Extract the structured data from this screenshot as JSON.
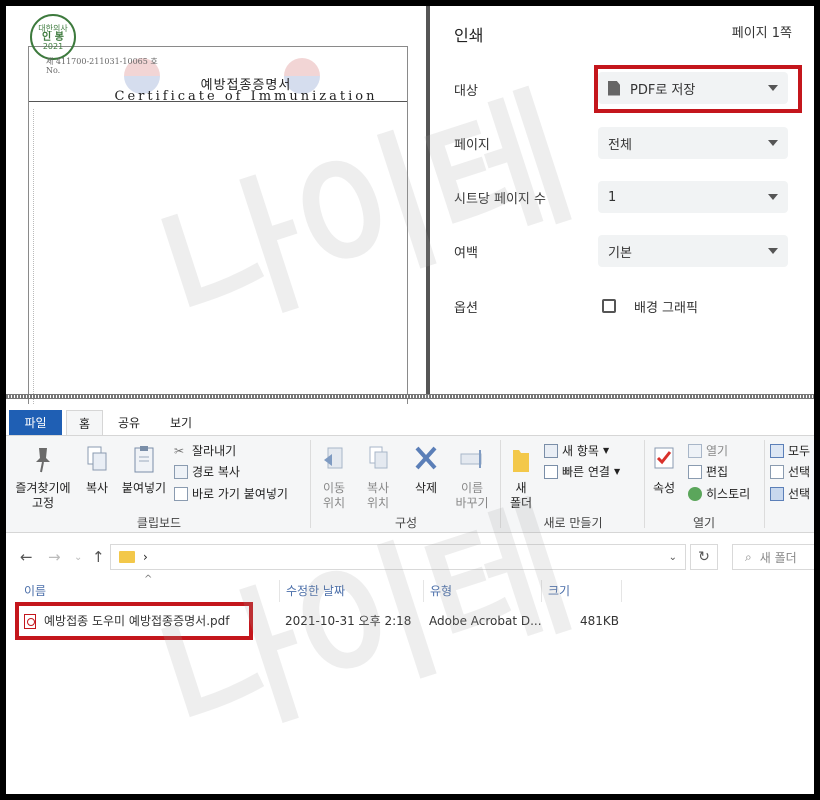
{
  "preview": {
    "stamp_top": "대한의사",
    "stamp_center": "인 봉",
    "stamp_bottom": "2021",
    "doc_number": "제  411700-211031-10065  호",
    "doc_no_label": "No.",
    "doc_title_kr": "예방접종증명서",
    "doc_title_en": "Certificate of Immunization"
  },
  "print_dialog": {
    "title": "인쇄",
    "page_count": "페이지 1쪽",
    "rows": [
      {
        "label": "대상",
        "value": "PDF로 저장",
        "icon": "pdf-file-icon",
        "highlighted": true
      },
      {
        "label": "페이지",
        "value": "전체"
      },
      {
        "label": "시트당 페이지 수",
        "value": "1"
      },
      {
        "label": "여백",
        "value": "기본"
      }
    ],
    "options_label": "옵션",
    "background_graphics_label": "배경 그래픽",
    "background_graphics_checked": false,
    "highlight_color": "#c4161c"
  },
  "explorer": {
    "tabs": [
      "파일",
      "홈",
      "공유",
      "보기"
    ],
    "active_tab": "홈",
    "file_tab_color": "#1f5fb4",
    "ribbon": {
      "clipboard": {
        "pin": "즐겨찾기에\n고정",
        "copy": "복사",
        "paste": "붙여넣기",
        "cut": "잘라내기",
        "copy_path": "경로 복사",
        "paste_shortcut": "바로 가기 붙여넣기",
        "group_label": "클립보드"
      },
      "organize": {
        "move_to": "이동\n위치",
        "copy_to": "복사\n위치",
        "delete": "삭제",
        "rename": "이름\n바꾸기",
        "group_label": "구성"
      },
      "new": {
        "new_folder": "새\n폴더",
        "new_item": "새 항목",
        "easy_access": "빠른 연결",
        "group_label": "새로 만들기"
      },
      "open": {
        "properties": "속성",
        "open": "열기",
        "edit": "편집",
        "history": "히스토리",
        "group_label": "열기"
      },
      "select": {
        "select_all": "모두",
        "select_none": "선택",
        "invert": "선택"
      }
    },
    "address": "›",
    "search_placeholder": "새 폴더",
    "columns": [
      "이름",
      "수정한 날짜",
      "유형",
      "크기"
    ],
    "files": [
      {
        "name": "예방접종 도우미 예방접종증명서.pdf",
        "modified": "2021-10-31 오후 2:18",
        "type": "Adobe Acrobat D...",
        "size": "481KB",
        "icon": "pdf-file-icon",
        "highlighted": true
      }
    ]
  },
  "watermark": "나이테"
}
